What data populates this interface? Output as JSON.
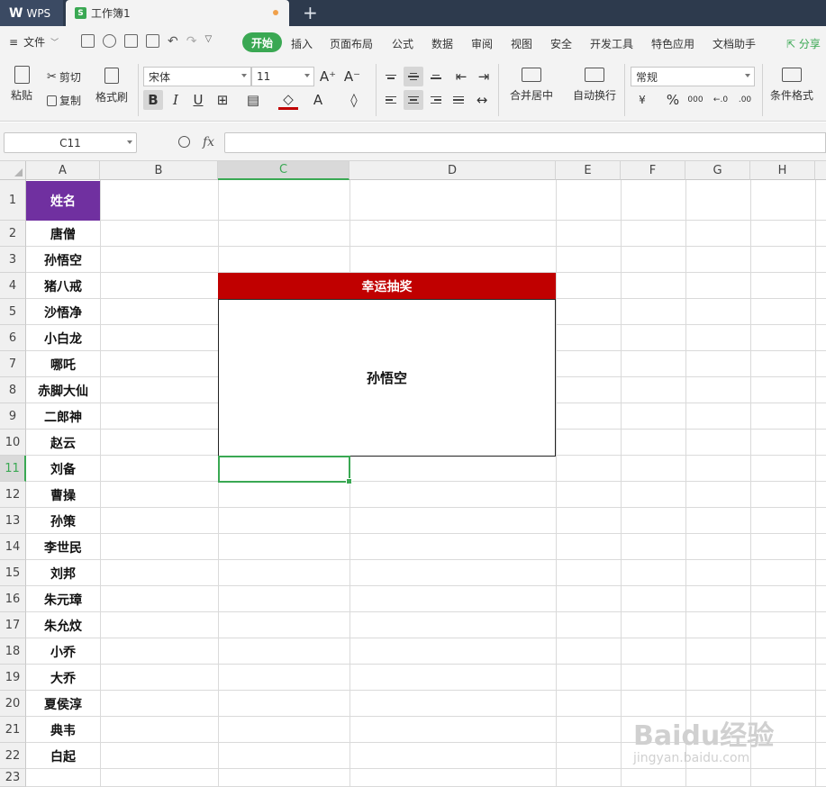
{
  "titlebar": {
    "app_tab": "WPS",
    "doc_tab": "工作簿1",
    "new_tab": "+"
  },
  "menubar": {
    "file": "文件",
    "items": [
      "开始",
      "插入",
      "页面布局",
      "公式",
      "数据",
      "审阅",
      "视图",
      "安全",
      "开发工具",
      "特色应用",
      "文档助手"
    ],
    "share": "分享"
  },
  "ribbon": {
    "paste": "粘贴",
    "cut": "剪切",
    "copy": "复制",
    "format_painter": "格式刷",
    "font_name": "宋体",
    "font_size": "11",
    "bold": "B",
    "italic": "I",
    "underline": "U",
    "merge_center": "合并居中",
    "wrap_text": "自动换行",
    "number_format": "常规",
    "percent": "%",
    "thousands": "000",
    "cond_format": "条件格式"
  },
  "formulabar": {
    "name_box": "C11",
    "fx": "fx",
    "formula": ""
  },
  "columns": [
    "A",
    "B",
    "C",
    "D",
    "E",
    "F",
    "G",
    "H"
  ],
  "selected_column": "C",
  "rows": [
    "1",
    "2",
    "3",
    "4",
    "5",
    "6",
    "7",
    "8",
    "9",
    "10",
    "11",
    "12",
    "13",
    "14",
    "15",
    "16",
    "17",
    "18",
    "19",
    "20",
    "21",
    "22",
    "23"
  ],
  "selected_row": "11",
  "sheet": {
    "header": "姓名",
    "names": [
      "唐僧",
      "孙悟空",
      "猪八戒",
      "沙悟净",
      "小白龙",
      "哪吒",
      "赤脚大仙",
      "二郎神",
      "赵云",
      "刘备",
      "曹操",
      "孙策",
      "李世民",
      "刘邦",
      "朱元璋",
      "朱允炆",
      "小乔",
      "大乔",
      "夏侯淳",
      "典韦",
      "白起"
    ],
    "lottery_title": "幸运抽奖",
    "lottery_result": "孙悟空"
  },
  "colors": {
    "accent": "#3aa853",
    "header_fill": "#7030a0",
    "lottery_fill": "#c00000"
  },
  "watermark": {
    "text": "Baidu经验",
    "sub": "jingyan.baidu.com"
  }
}
